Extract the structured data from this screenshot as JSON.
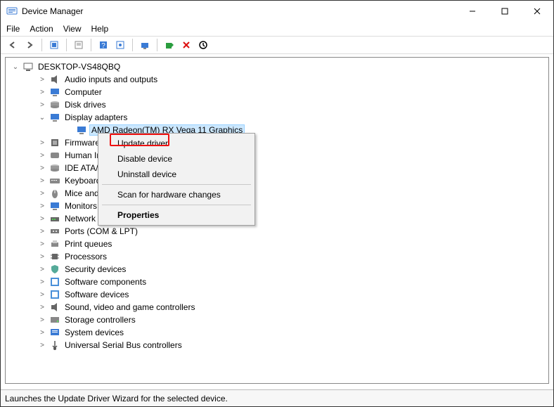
{
  "window": {
    "title": "Device Manager"
  },
  "menu": {
    "file": "File",
    "action": "Action",
    "view": "View",
    "help": "Help"
  },
  "tree": {
    "root": "DESKTOP-VS48QBQ",
    "items": [
      {
        "label": "Audio inputs and outputs",
        "icon": "speaker"
      },
      {
        "label": "Computer",
        "icon": "monitor"
      },
      {
        "label": "Disk drives",
        "icon": "disk"
      },
      {
        "label": "Display adapters",
        "icon": "monitor",
        "expanded": true,
        "children": [
          {
            "label": "AMD Radeon(TM) RX Vega 11 Graphics",
            "icon": "monitor",
            "selected": true
          }
        ]
      },
      {
        "label": "Firmware",
        "icon": "chip"
      },
      {
        "label": "Human Inte",
        "icon": "hid",
        "truncated": true
      },
      {
        "label": "IDE ATA/ATA",
        "icon": "disk",
        "truncated": true
      },
      {
        "label": "Keyboards",
        "icon": "keyboard"
      },
      {
        "label": "Mice and ot",
        "icon": "mouse",
        "truncated": true
      },
      {
        "label": "Monitors",
        "icon": "monitor"
      },
      {
        "label": "Network ad",
        "icon": "network",
        "truncated": true
      },
      {
        "label": "Ports (COM & LPT)",
        "icon": "port"
      },
      {
        "label": "Print queues",
        "icon": "printer"
      },
      {
        "label": "Processors",
        "icon": "cpu"
      },
      {
        "label": "Security devices",
        "icon": "security"
      },
      {
        "label": "Software components",
        "icon": "software"
      },
      {
        "label": "Software devices",
        "icon": "software"
      },
      {
        "label": "Sound, video and game controllers",
        "icon": "speaker"
      },
      {
        "label": "Storage controllers",
        "icon": "storage"
      },
      {
        "label": "System devices",
        "icon": "system"
      },
      {
        "label": "Universal Serial Bus controllers",
        "icon": "usb"
      }
    ]
  },
  "context_menu": {
    "update": "Update driver",
    "disable": "Disable device",
    "uninstall": "Uninstall device",
    "scan": "Scan for hardware changes",
    "properties": "Properties"
  },
  "statusbar": {
    "text": "Launches the Update Driver Wizard for the selected device."
  }
}
